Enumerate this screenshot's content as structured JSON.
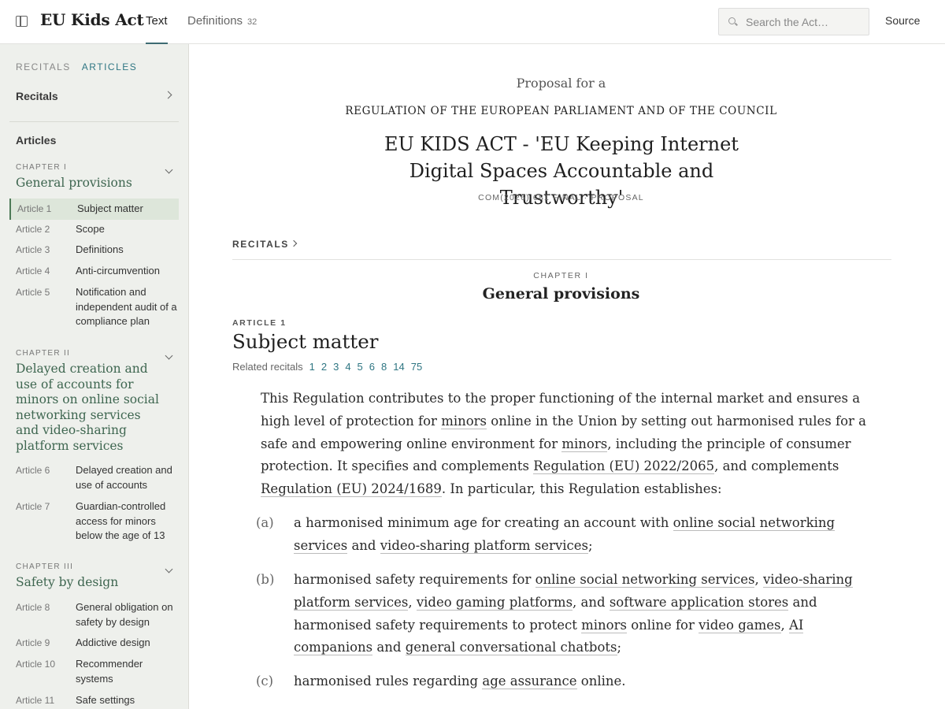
{
  "header": {
    "title": "EU Kids Act",
    "tabs": [
      {
        "label": "Text"
      },
      {
        "label": "Definitions",
        "count": "32"
      }
    ],
    "search_placeholder": "Search the Act…",
    "source_label": "Source"
  },
  "sidebar": {
    "toggle_recitals": "RECITALS",
    "toggle_articles": "ARTICLES",
    "recitals_label": "Recitals",
    "articles_label": "Articles",
    "chapters": [
      {
        "label": "CHAPTER I",
        "title": "General provisions",
        "articles": [
          {
            "num": "Article 1",
            "title": "Subject matter"
          },
          {
            "num": "Article 2",
            "title": "Scope"
          },
          {
            "num": "Article 3",
            "title": "Definitions"
          },
          {
            "num": "Article 4",
            "title": "Anti-circumvention"
          },
          {
            "num": "Article 5",
            "title": "Notification and independent audit of a compliance plan"
          }
        ]
      },
      {
        "label": "CHAPTER II",
        "title": "Delayed creation and use of accounts for minors on online social networking services and video-sharing platform services",
        "articles": [
          {
            "num": "Article 6",
            "title": "Delayed creation and use of accounts"
          },
          {
            "num": "Article 7",
            "title": "Guardian-controlled access for minors below the age of 13"
          }
        ]
      },
      {
        "label": "CHAPTER III",
        "title": "Safety by design",
        "articles": [
          {
            "num": "Article 8",
            "title": "General obligation on safety by design"
          },
          {
            "num": "Article 9",
            "title": "Addictive design"
          },
          {
            "num": "Article 10",
            "title": "Recommender systems"
          },
          {
            "num": "Article 11",
            "title": "Safe settings"
          }
        ]
      }
    ]
  },
  "main": {
    "proposal_for": "Proposal for a",
    "regulation_of": "REGULATION OF THE EUROPEAN PARLIAMENT AND OF THE COUNCIL",
    "act_title": "EU KIDS ACT - 'EU Keeping Internet Digital Spaces Accountable and Trustworthy'",
    "reference": "COM(2026) 681 FINAL · PROPOSAL",
    "recitals_link": "RECITALS",
    "chapter_label": "CHAPTER I",
    "chapter_title": "General provisions",
    "article_label": "ARTICLE 1",
    "article_title": "Subject matter",
    "related_label": "Related recitals",
    "related_recitals": [
      "1",
      "2",
      "3",
      "4",
      "5",
      "6",
      "8",
      "14",
      "75"
    ],
    "paragraph": {
      "p1": "This Regulation contributes to the proper functioning of the internal market and ensures a high level of protection for ",
      "t1": "minors",
      "p2": " online in the Union by setting out harmonised rules for a safe and empowering online environment for ",
      "t2": "minors",
      "p3": ", including the principle of consumer protection. It specifies and complements ",
      "t3": "Regulation (EU) 2022/2065",
      "p4": ", and complements ",
      "t4": "Regulation (EU) 2024/1689",
      "p5": ". In particular, this Regulation establishes:"
    },
    "items": [
      {
        "label": "(a)",
        "p1": "a harmonised minimum age for creating an account with ",
        "t1": "online social networking services",
        "p2": " and ",
        "t2": "video-sharing platform services",
        "p3": ";"
      },
      {
        "label": "(b)",
        "p1": "harmonised safety requirements for ",
        "t1": "online social networking services",
        "p2": ", ",
        "t2": "video-sharing platform services",
        "p3": ", ",
        "t3": "video gaming platforms",
        "p4": ", and ",
        "t4": "software application stores",
        "p5": " and harmonised safety requirements to protect ",
        "t5": "minors",
        "p6": " online for ",
        "t6": "video games",
        "p7": ", ",
        "t7": "AI companions",
        "p8": " and ",
        "t8": "general conversational chatbots",
        "p9": ";"
      },
      {
        "label": "(c)",
        "p1": "harmonised rules regarding ",
        "t1": "age assurance",
        "p2": " online."
      }
    ]
  }
}
